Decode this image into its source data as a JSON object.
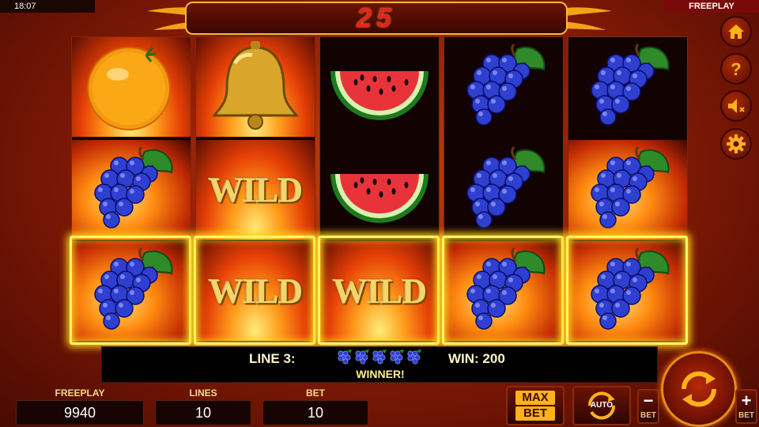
{
  "status_bar": {
    "time": "18:07",
    "mode": "FREEPLAY"
  },
  "counter": {
    "value": "25"
  },
  "reels": [
    [
      "orange",
      "grapes",
      "grapes"
    ],
    [
      "wild-bell",
      "wild",
      "wild"
    ],
    [
      "watermelon",
      "watermelon",
      "wild"
    ],
    [
      "grapes",
      "grapes",
      "grapes"
    ],
    [
      "grapes",
      "grapes",
      "grapes"
    ]
  ],
  "symbols": {
    "wild_label": "WILD"
  },
  "winning_line": {
    "row": 3,
    "reels": [
      1,
      2,
      3,
      4,
      5
    ]
  },
  "win_info": {
    "line_label": "LINE 3:",
    "win_label": "WIN: 200",
    "status": "WINNER!",
    "line_symbol_count": 5,
    "line_symbol": "grapes"
  },
  "bottom": {
    "freeplay_label": "FREEPLAY",
    "freeplay_value": "9940",
    "lines_label": "LINES",
    "lines_value": "10",
    "bet_label": "BET",
    "bet_value": "10"
  },
  "buttons": {
    "max_top": "MAX",
    "max_bottom": "BET",
    "auto": "AUTO",
    "bet_minus": "−",
    "bet_plus": "+",
    "bet_small": "BET"
  },
  "side_menu": [
    "home-icon",
    "help-icon",
    "sound-muted-icon",
    "settings-gear-icon"
  ],
  "colors": {
    "gold": "#f6b73c",
    "win_glow": "#fff36a",
    "counter_red": "#e3241b",
    "grape": "#2f3fd0"
  }
}
